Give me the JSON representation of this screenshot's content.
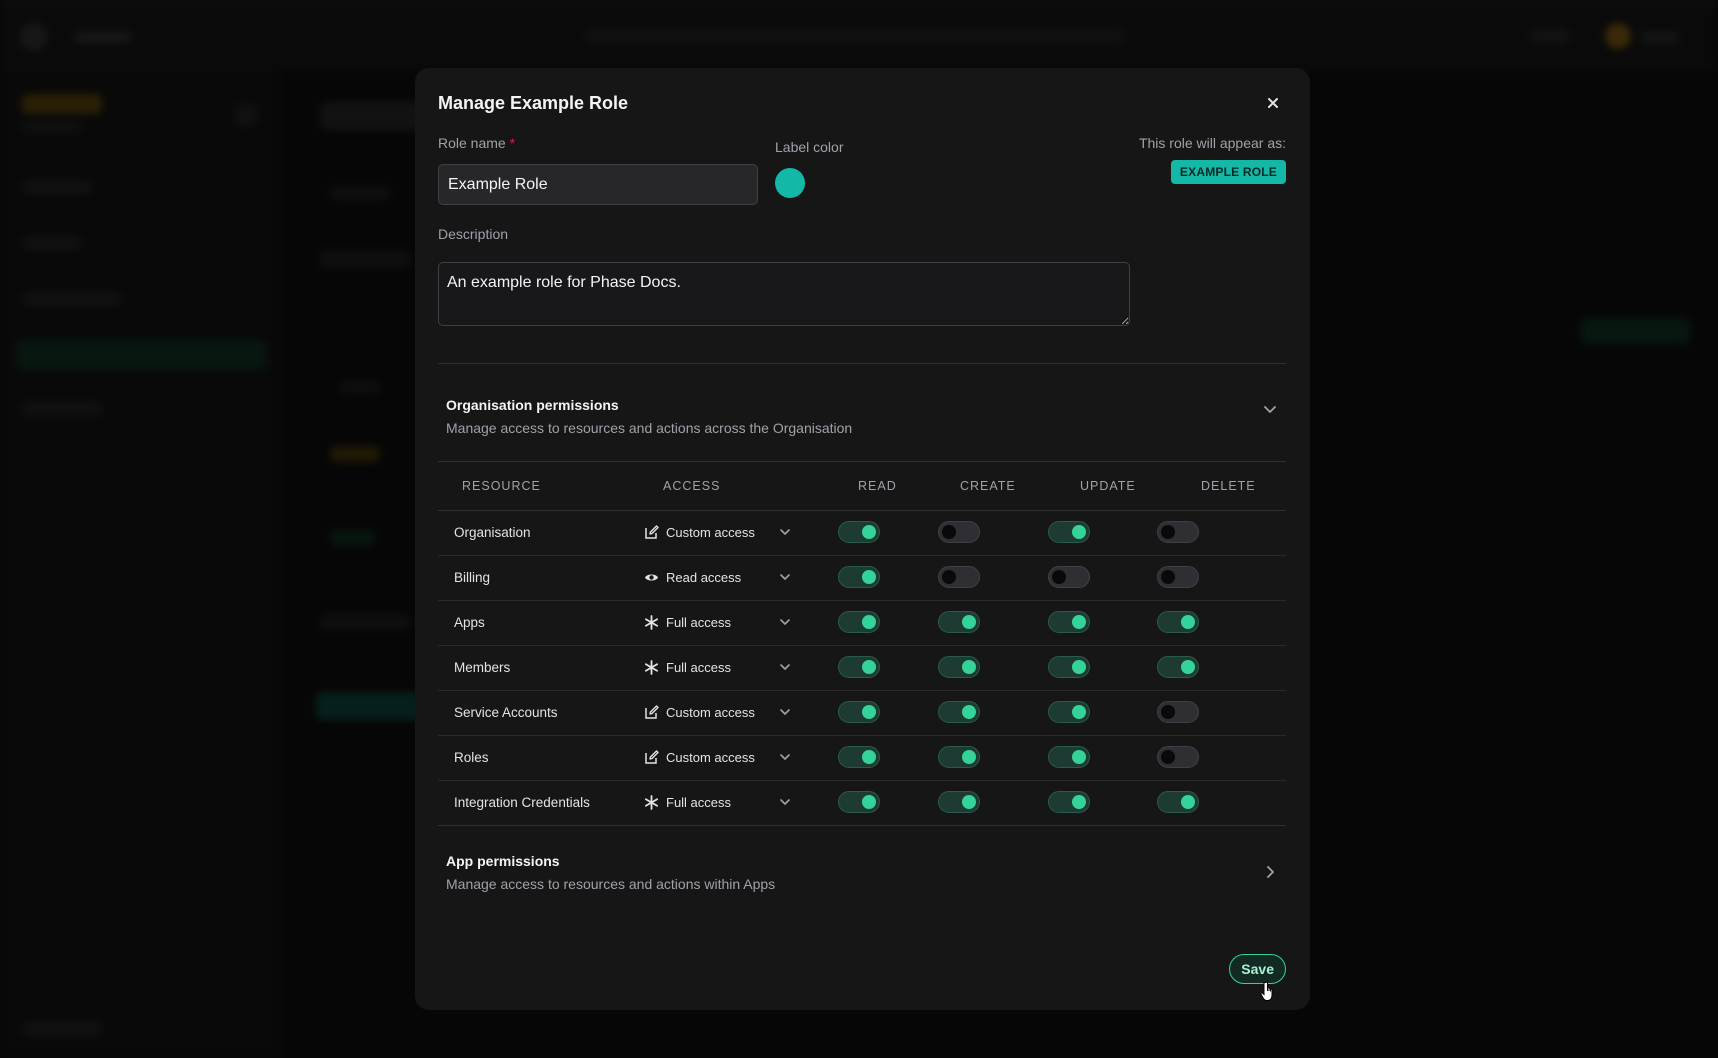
{
  "modal": {
    "title": "Manage Example Role",
    "role_name_label": "Role name",
    "role_name_required": "*",
    "role_name_value": "Example Role",
    "label_color_label": "Label color",
    "label_color": "#14b8a6",
    "appear_label": "This role will appear as:",
    "badge_text": "EXAMPLE ROLE",
    "description_label": "Description",
    "description_value": "An example role for Phase Docs.",
    "save_label": "Save"
  },
  "org_permissions": {
    "title": "Organisation permissions",
    "subtitle": "Manage access to resources and actions across the Organisation",
    "columns": [
      "RESOURCE",
      "ACCESS",
      "READ",
      "CREATE",
      "UPDATE",
      "DELETE"
    ],
    "rows": [
      {
        "resource": "Organisation",
        "access": "Custom access",
        "access_icon": "edit-icon",
        "read": true,
        "create": false,
        "update": true,
        "delete": false
      },
      {
        "resource": "Billing",
        "access": "Read access",
        "access_icon": "eye-icon",
        "read": true,
        "create": false,
        "update": false,
        "delete": false
      },
      {
        "resource": "Apps",
        "access": "Full access",
        "access_icon": "asterisk-icon",
        "read": true,
        "create": true,
        "update": true,
        "delete": true
      },
      {
        "resource": "Members",
        "access": "Full access",
        "access_icon": "asterisk-icon",
        "read": true,
        "create": true,
        "update": true,
        "delete": true
      },
      {
        "resource": "Service Accounts",
        "access": "Custom access",
        "access_icon": "edit-icon",
        "read": true,
        "create": true,
        "update": true,
        "delete": false
      },
      {
        "resource": "Roles",
        "access": "Custom access",
        "access_icon": "edit-icon",
        "read": true,
        "create": true,
        "update": true,
        "delete": false
      },
      {
        "resource": "Integration Credentials",
        "access": "Full access",
        "access_icon": "asterisk-icon",
        "read": true,
        "create": true,
        "update": true,
        "delete": true
      }
    ]
  },
  "app_permissions": {
    "title": "App permissions",
    "subtitle": "Manage access to resources and actions within Apps"
  },
  "colors": {
    "accent": "#34d399",
    "teal": "#14b8a6",
    "modal_bg": "#161617"
  }
}
